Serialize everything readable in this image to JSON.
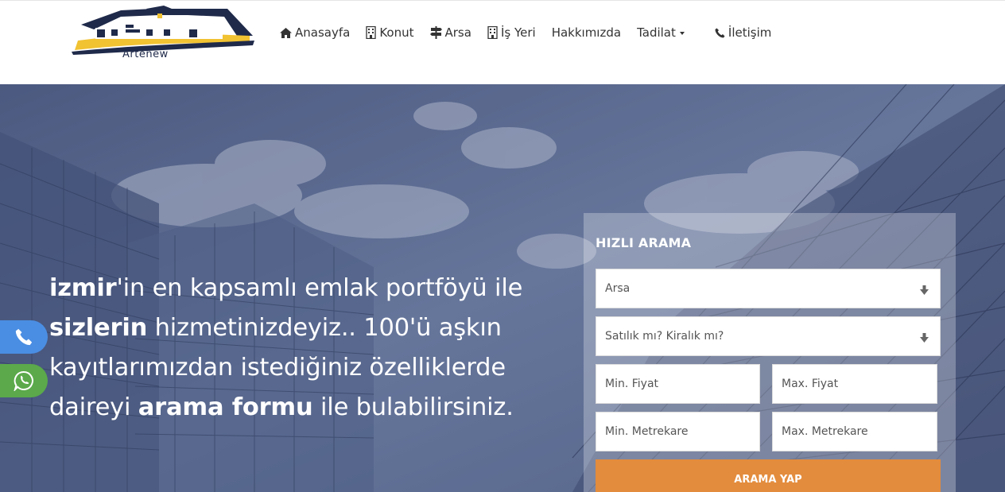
{
  "brand": {
    "name": "Artenew"
  },
  "nav": {
    "items": [
      {
        "label": "Anasayfa",
        "icon": "home-icon"
      },
      {
        "label": "Konut",
        "icon": "building-icon"
      },
      {
        "label": "Arsa",
        "icon": "signpost-icon"
      },
      {
        "label": "İş Yeri",
        "icon": "building-icon"
      },
      {
        "label": "Hakkımızda"
      },
      {
        "label": "Tadilat",
        "icon": "caret-down-icon"
      },
      {
        "label": "İletişim",
        "icon": "phone-icon"
      }
    ]
  },
  "hero": {
    "line1_bold": "izmir",
    "line1_rest": "'in en kapsamlı emlak portföyü ile",
    "line2_bold": "sizlerin",
    "line2_rest": " hizmetinizdeyiz.. 100'ü aşkın",
    "line3": "kayıtlarımızdan istediğiniz özelliklerde",
    "line4_start": "daireyi ",
    "line4_bold": "arama formu",
    "line4_rest": " ile bulabilirsiniz."
  },
  "search": {
    "title": "HIZLI ARAMA",
    "type_selected": "Arsa",
    "status_placeholder": "Satılık mı? Kiralık mı?",
    "min_price_placeholder": "Min. Fiyat",
    "max_price_placeholder": "Max. Fiyat",
    "min_area_placeholder": "Min. Metrekare",
    "max_area_placeholder": "Max. Metrekare",
    "button_label": "ARAMA YAP"
  },
  "colors": {
    "accent": "#e38c3d",
    "phone_button": "#4a8ee3",
    "whatsapp_button": "#5ba94b",
    "logo_navy": "#1f2a4a",
    "logo_yellow": "#f1c232"
  }
}
